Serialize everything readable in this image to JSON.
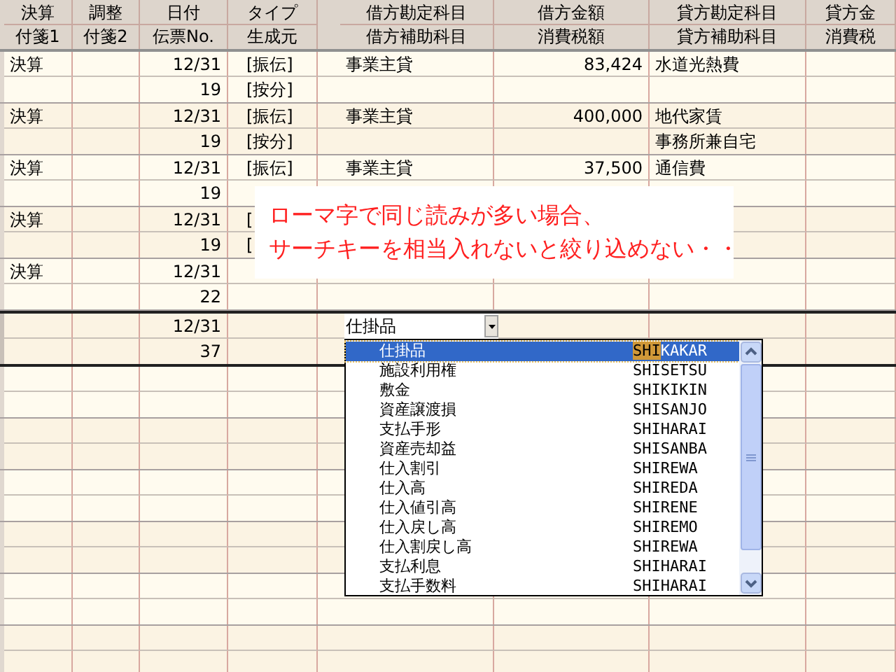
{
  "columns": [
    {
      "top": "決算",
      "bottom": "付箋1"
    },
    {
      "top": "調整",
      "bottom": "付箋2"
    },
    {
      "top": "日付",
      "bottom": "伝票No."
    },
    {
      "top": "タイプ",
      "bottom": "生成元"
    },
    {
      "top": "借方勘定科目",
      "bottom": "借方補助科目"
    },
    {
      "top": "借方金額",
      "bottom": "消費税額"
    },
    {
      "top": "貸方勘定科目",
      "bottom": "貸方補助科目"
    },
    {
      "top": "貸方金",
      "bottom": "消費税"
    }
  ],
  "entries": [
    {
      "current": false,
      "tag": "決算",
      "date": "12/31",
      "slip": "19",
      "source": "[振伝]",
      "source2": "[按分]",
      "debit_account": "事業主貸",
      "debit_amount": "83,424",
      "credit_account": "水道光熱費"
    },
    {
      "current": false,
      "tag": "決算",
      "date": "12/31",
      "slip": "19",
      "source": "[振伝]",
      "source2": "[按分]",
      "debit_account": "事業主貸",
      "debit_amount": "400,000",
      "credit_account": "地代家賃",
      "credit_sub": "事務所兼自宅"
    },
    {
      "current": false,
      "tag": "決算",
      "date": "12/31",
      "slip": "19",
      "source": "[振伝]",
      "debit_account": "事業主貸",
      "debit_amount": "37,500",
      "credit_account": "通信費"
    },
    {
      "current": false,
      "tag": "決算",
      "date": "12/31",
      "slip": "19",
      "source": "[",
      "source2": "["
    },
    {
      "current": false,
      "tag": "決算",
      "date": "12/31",
      "slip": "22"
    },
    {
      "current": true,
      "date": "12/31",
      "slip": "37"
    }
  ],
  "editor": {
    "value": "仕掛品",
    "items": [
      {
        "name": "仕掛品",
        "code_match": "SHI",
        "code_rest": "KAKAR",
        "selected": true
      },
      {
        "name": "施設利用権",
        "code": "SHISETSU",
        "selected": false
      },
      {
        "name": "敷金",
        "code": "SHIKIKIN",
        "selected": false
      },
      {
        "name": "資産譲渡損",
        "code": "SHISANJO",
        "selected": false
      },
      {
        "name": "支払手形",
        "code": "SHIHARAI",
        "selected": false
      },
      {
        "name": "資産売却益",
        "code": "SHISANBA",
        "selected": false
      },
      {
        "name": "仕入割引",
        "code": "SHIREWA",
        "selected": false
      },
      {
        "name": "仕入高",
        "code": "SHIREDA",
        "selected": false
      },
      {
        "name": "仕入値引高",
        "code": "SHIRENE",
        "selected": false
      },
      {
        "name": "仕入戻し高",
        "code": "SHIREMO",
        "selected": false
      },
      {
        "name": "仕入割戻し高",
        "code": "SHIREWA",
        "selected": false
      },
      {
        "name": "支払利息",
        "code": "SHIHARAI",
        "selected": false
      },
      {
        "name": "支払手数料",
        "code": "SHIHARAI",
        "selected": false
      }
    ]
  },
  "callout": [
    "ローマ字で同じ読みが多い場合、",
    "サーチキーを相当入れないと絞り込めない・・"
  ]
}
